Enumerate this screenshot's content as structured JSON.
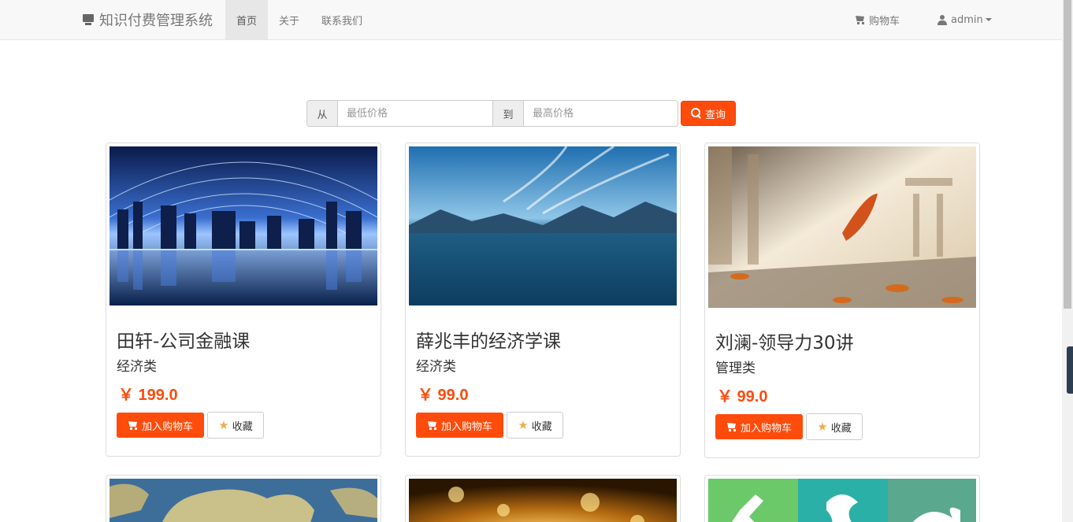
{
  "navbar": {
    "brand": "知识付费管理系统",
    "links": [
      {
        "label": "首页",
        "active": true
      },
      {
        "label": "关于",
        "active": false
      },
      {
        "label": "联系我们",
        "active": false
      }
    ],
    "cart_label": "购物车",
    "user_label": "admin"
  },
  "search": {
    "from_label": "从",
    "min_placeholder": "最低价格",
    "to_label": "到",
    "max_placeholder": "最高价格",
    "button_label": "查询"
  },
  "courses": [
    {
      "title": "田轩-公司金融课",
      "category": "经济类",
      "price": "￥ 199.0",
      "image": "city-network-night",
      "cart_label": "加入购物车",
      "fav_label": "收藏"
    },
    {
      "title": "薛兆丰的经济学课",
      "category": "经济类",
      "price": "￥ 99.0",
      "image": "lake-mountains",
      "cart_label": "加入购物车",
      "fav_label": "收藏"
    },
    {
      "title": "刘澜-领导力30讲",
      "category": "管理类",
      "price": "￥ 99.0",
      "image": "autumn-leaf",
      "cart_label": "加入购物车",
      "fav_label": "收藏"
    }
  ],
  "courses_row2_images": [
    "world-map",
    "golden-coins",
    "colored-tiles-letters"
  ],
  "colors": {
    "accent": "#ff4b0b",
    "navbar_bg": "#f8f8f8",
    "star": "#f0ad4e"
  }
}
